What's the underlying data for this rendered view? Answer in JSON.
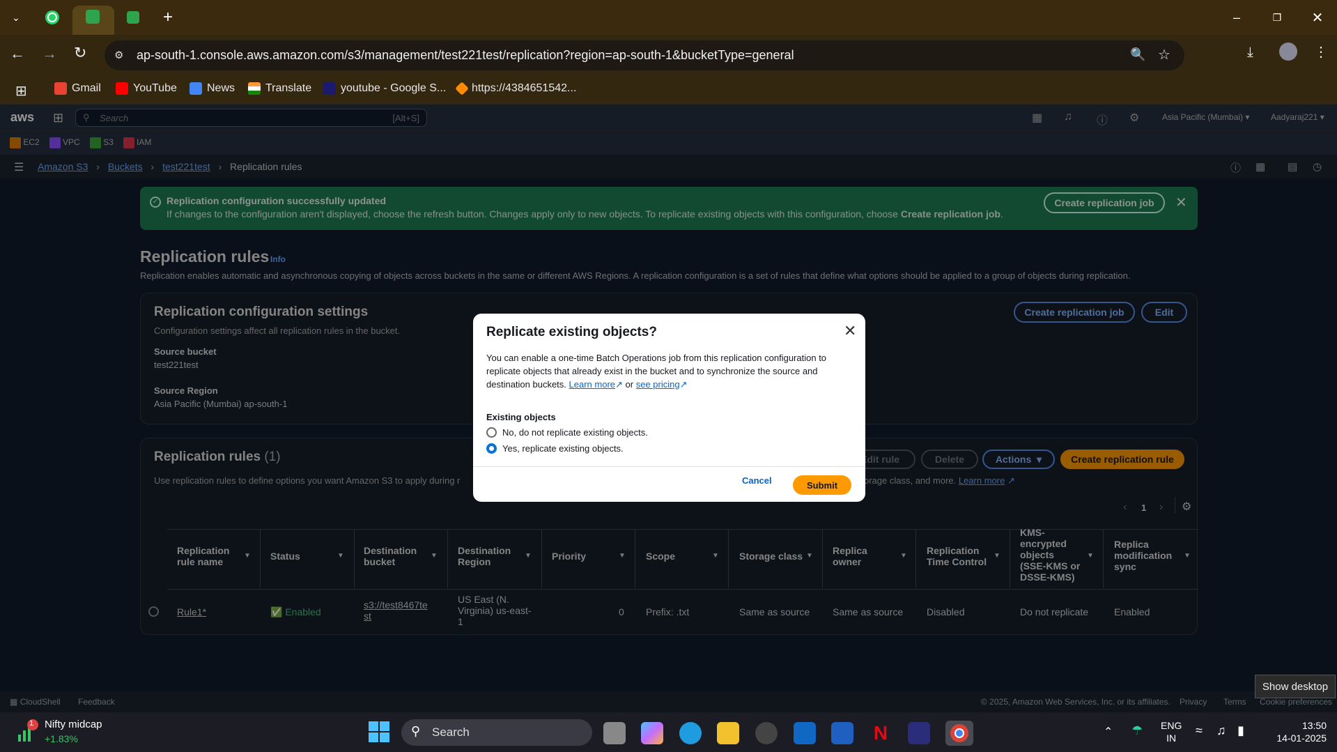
{
  "browser": {
    "url": "ap-south-1.console.aws.amazon.com/s3/management/test221test/replication?region=ap-south-1&bucketType=general",
    "bookmarks": [
      "Gmail",
      "YouTube",
      "News",
      "Translate",
      "youtube - Google S...",
      "https://4384651542..."
    ]
  },
  "aws": {
    "logo": "aws",
    "search_placeholder": "Search",
    "search_shortcut": "[Alt+S]",
    "region": "Asia Pacific (Mumbai) ▾",
    "user": "Aadyaraj221 ▾",
    "services": [
      "EC2",
      "VPC",
      "S3",
      "IAM"
    ],
    "breadcrumb": [
      "Amazon S3",
      "Buckets",
      "test221test",
      "Replication rules"
    ]
  },
  "banner": {
    "title": "Replication configuration successfully updated",
    "text": "If changes to the configuration aren't displayed, choose the refresh button. Changes apply only to new objects. To replicate existing objects with this configuration, choose",
    "text_bold": "Create replication job",
    "button": "Create replication job"
  },
  "page": {
    "title": "Replication rules",
    "info": "Info",
    "description": "Replication enables automatic and asynchronous copying of objects across buckets in the same or different AWS Regions. A replication configuration is a set of rules that define what options should be applied to a group of objects during replication."
  },
  "config": {
    "title": "Replication configuration settings",
    "subtitle": "Configuration settings affect all replication rules in the bucket.",
    "create_job": "Create replication job",
    "edit": "Edit",
    "source_bucket_label": "Source bucket",
    "source_bucket": "test221test",
    "source_region_label": "Source Region",
    "source_region": "Asia Pacific (Mumbai) ap-south-1"
  },
  "rules": {
    "title": "Replication rules",
    "count": "(1)",
    "desc_start": "Use replication rules to define options you want Amazon S3 to apply during r",
    "desc_end": "orage class, and more.",
    "learn_more": "Learn more",
    "edit_rule": "Edit rule",
    "delete": "Delete",
    "actions": "Actions",
    "create_rule": "Create replication rule",
    "page": "1",
    "columns": [
      "Replication rule name",
      "Status",
      "Destination bucket",
      "Destination Region",
      "Priority",
      "Scope",
      "Storage class",
      "Replica owner",
      "Replication Time Control",
      "KMS-encrypted objects (SSE-KMS or DSSE-KMS)",
      "Replica modification sync"
    ],
    "row": {
      "name": "Rule1*",
      "status": "Enabled",
      "bucket": "s3://test8467test",
      "region": "US East (N. Virginia) us-east-1",
      "priority": "0",
      "scope": "Prefix: .txt",
      "storage": "Same as source",
      "owner": "Same as source",
      "rtc": "Disabled",
      "kms": "Do not replicate",
      "sync": "Enabled"
    }
  },
  "modal": {
    "title": "Replicate existing objects?",
    "body": "You can enable a one-time Batch Operations job from this replication configuration to replicate objects that already exist in the bucket and to synchronize the source and destination buckets.",
    "learn_more": "Learn more",
    "or": "or",
    "see_pricing": "see pricing",
    "group_label": "Existing objects",
    "option_no": "No, do not replicate existing objects.",
    "option_yes": "Yes, replicate existing objects.",
    "selected": "yes",
    "cancel": "Cancel",
    "submit": "Submit"
  },
  "footer": {
    "cloudshell": "CloudShell",
    "feedback": "Feedback",
    "copyright": "© 2025, Amazon Web Services, Inc. or its affiliates.",
    "privacy": "Privacy",
    "terms": "Terms",
    "cookie": "Cookie preferences"
  },
  "taskbar": {
    "widget_title": "Nifty midcap",
    "widget_value": "+1.83%",
    "widget_badge": "1",
    "search": "Search",
    "lang1": "ENG",
    "lang2": "IN",
    "time": "13:50",
    "date": "14-01-2025",
    "tooltip": "Show desktop"
  },
  "colors": {
    "accent": "#ff9900",
    "banner": "#1d7a52",
    "link": "#6aa7ff",
    "aws_header": "#232f3e"
  }
}
